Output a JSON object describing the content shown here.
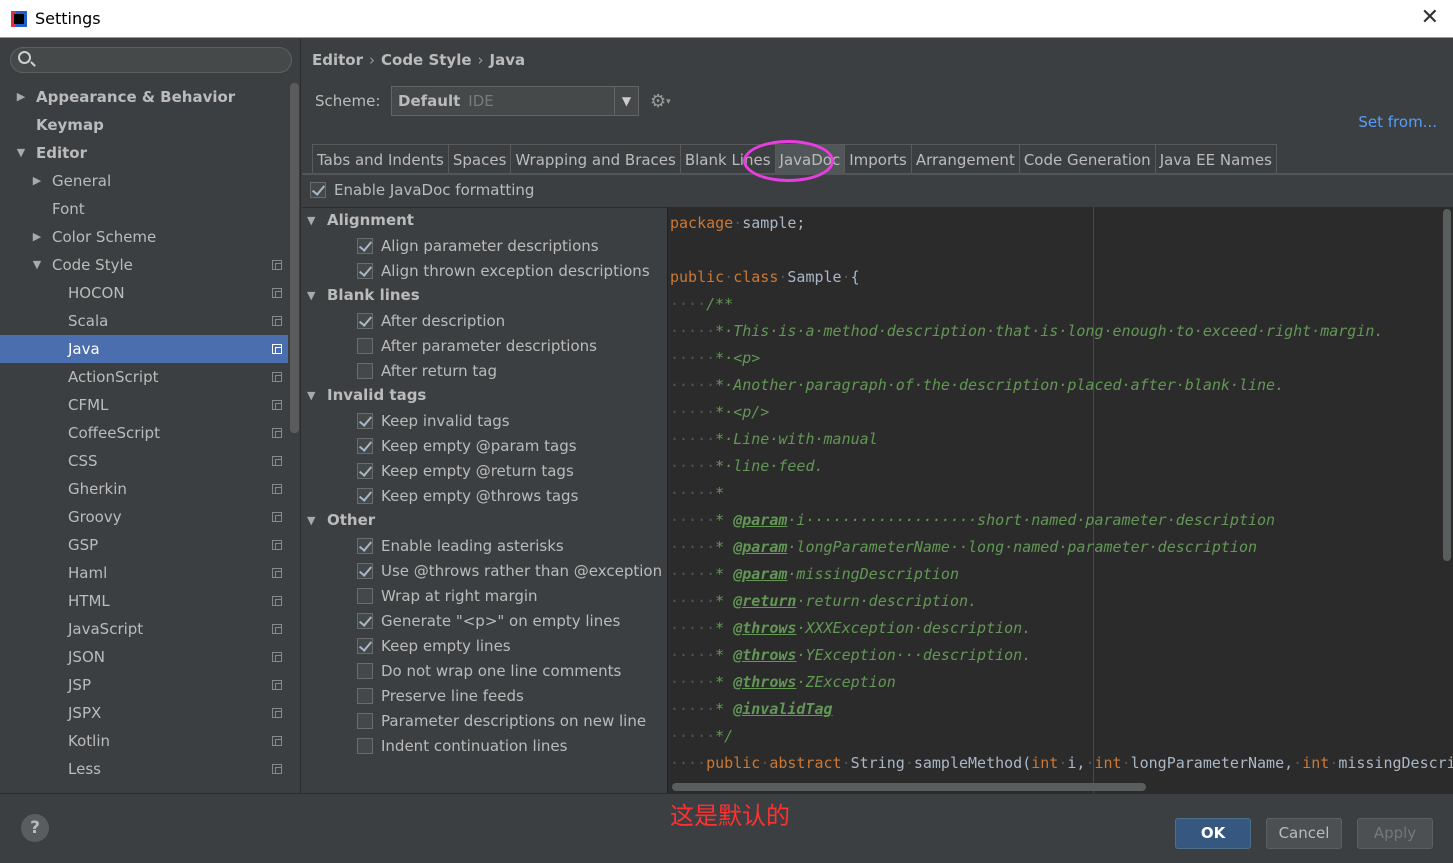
{
  "window": {
    "title": "Settings"
  },
  "sidebar": {
    "search_placeholder": "",
    "items": [
      {
        "label": "Appearance & Behavior",
        "level": 0,
        "arrow": "collapsed",
        "bold": true,
        "copy": false
      },
      {
        "label": "Keymap",
        "level": 0,
        "arrow": "none",
        "bold": true,
        "copy": false
      },
      {
        "label": "Editor",
        "level": 0,
        "arrow": "expanded",
        "bold": true,
        "copy": false
      },
      {
        "label": "General",
        "level": 1,
        "arrow": "collapsed",
        "bold": false,
        "copy": false
      },
      {
        "label": "Font",
        "level": 1,
        "arrow": "none",
        "bold": false,
        "copy": false
      },
      {
        "label": "Color Scheme",
        "level": 1,
        "arrow": "collapsed",
        "bold": false,
        "copy": false
      },
      {
        "label": "Code Style",
        "level": 1,
        "arrow": "expanded",
        "bold": false,
        "copy": true
      },
      {
        "label": "HOCON",
        "level": 2,
        "arrow": "none",
        "bold": false,
        "copy": true
      },
      {
        "label": "Scala",
        "level": 2,
        "arrow": "none",
        "bold": false,
        "copy": true
      },
      {
        "label": "Java",
        "level": 2,
        "arrow": "none",
        "bold": false,
        "copy": true,
        "selected": true
      },
      {
        "label": "ActionScript",
        "level": 2,
        "arrow": "none",
        "bold": false,
        "copy": true
      },
      {
        "label": "CFML",
        "level": 2,
        "arrow": "none",
        "bold": false,
        "copy": true
      },
      {
        "label": "CoffeeScript",
        "level": 2,
        "arrow": "none",
        "bold": false,
        "copy": true
      },
      {
        "label": "CSS",
        "level": 2,
        "arrow": "none",
        "bold": false,
        "copy": true
      },
      {
        "label": "Gherkin",
        "level": 2,
        "arrow": "none",
        "bold": false,
        "copy": true
      },
      {
        "label": "Groovy",
        "level": 2,
        "arrow": "none",
        "bold": false,
        "copy": true
      },
      {
        "label": "GSP",
        "level": 2,
        "arrow": "none",
        "bold": false,
        "copy": true
      },
      {
        "label": "Haml",
        "level": 2,
        "arrow": "none",
        "bold": false,
        "copy": true
      },
      {
        "label": "HTML",
        "level": 2,
        "arrow": "none",
        "bold": false,
        "copy": true
      },
      {
        "label": "JavaScript",
        "level": 2,
        "arrow": "none",
        "bold": false,
        "copy": true
      },
      {
        "label": "JSON",
        "level": 2,
        "arrow": "none",
        "bold": false,
        "copy": true
      },
      {
        "label": "JSP",
        "level": 2,
        "arrow": "none",
        "bold": false,
        "copy": true
      },
      {
        "label": "JSPX",
        "level": 2,
        "arrow": "none",
        "bold": false,
        "copy": true
      },
      {
        "label": "Kotlin",
        "level": 2,
        "arrow": "none",
        "bold": false,
        "copy": true
      },
      {
        "label": "Less",
        "level": 2,
        "arrow": "none",
        "bold": false,
        "copy": true
      }
    ]
  },
  "breadcrumb": [
    "Editor",
    "Code Style",
    "Java"
  ],
  "scheme": {
    "label": "Scheme:",
    "value": "Default",
    "sub": "IDE"
  },
  "set_from": "Set from...",
  "tabs": [
    {
      "label": "Tabs and Indents",
      "active": false
    },
    {
      "label": "Spaces",
      "active": false
    },
    {
      "label": "Wrapping and Braces",
      "active": false
    },
    {
      "label": "Blank Lines",
      "active": false
    },
    {
      "label": "JavaDoc",
      "active": true
    },
    {
      "label": "Imports",
      "active": false
    },
    {
      "label": "Arrangement",
      "active": false
    },
    {
      "label": "Code Generation",
      "active": false
    },
    {
      "label": "Java EE Names",
      "active": false
    }
  ],
  "enable_javadoc": {
    "label": "Enable JavaDoc formatting",
    "checked": true
  },
  "option_groups": [
    {
      "title": "Alignment",
      "options": [
        {
          "label": "Align parameter descriptions",
          "checked": true
        },
        {
          "label": "Align thrown exception descriptions",
          "checked": true
        }
      ]
    },
    {
      "title": "Blank lines",
      "options": [
        {
          "label": "After description",
          "checked": true
        },
        {
          "label": "After parameter descriptions",
          "checked": false
        },
        {
          "label": "After return tag",
          "checked": false
        }
      ]
    },
    {
      "title": "Invalid tags",
      "options": [
        {
          "label": "Keep invalid tags",
          "checked": true
        },
        {
          "label": "Keep empty @param tags",
          "checked": true
        },
        {
          "label": "Keep empty @return tags",
          "checked": true
        },
        {
          "label": "Keep empty @throws tags",
          "checked": true
        }
      ]
    },
    {
      "title": "Other",
      "options": [
        {
          "label": "Enable leading asterisks",
          "checked": true
        },
        {
          "label": "Use @throws rather than @exception",
          "checked": true
        },
        {
          "label": "Wrap at right margin",
          "checked": false
        },
        {
          "label": "Generate \"<p>\" on empty lines",
          "checked": true
        },
        {
          "label": "Keep empty lines",
          "checked": true
        },
        {
          "label": "Do not wrap one line comments",
          "checked": false
        },
        {
          "label": "Preserve line feeds",
          "checked": false
        },
        {
          "label": "Parameter descriptions on new line",
          "checked": false
        },
        {
          "label": "Indent continuation lines",
          "checked": false
        }
      ]
    }
  ],
  "code_lines": [
    [
      [
        "kw",
        "package"
      ],
      [
        "dot",
        "·"
      ],
      [
        "id",
        "sample;"
      ]
    ],
    [],
    [
      [
        "kw",
        "public"
      ],
      [
        "dot",
        "·"
      ],
      [
        "kw",
        "class"
      ],
      [
        "dot",
        "·"
      ],
      [
        "id",
        "Sample"
      ],
      [
        "dot",
        "·"
      ],
      [
        "id",
        "{"
      ]
    ],
    [
      [
        "dot",
        "····"
      ],
      [
        "cm",
        "/**"
      ]
    ],
    [
      [
        "dot",
        "·····"
      ],
      [
        "cm",
        "*·This·is·a·method·description·that·is·long·enough·to·exceed·right·margin."
      ]
    ],
    [
      [
        "dot",
        "·····"
      ],
      [
        "cm",
        "*·<p>"
      ]
    ],
    [
      [
        "dot",
        "·····"
      ],
      [
        "cm",
        "*·Another·paragraph·of·the·description·placed·after·blank·line."
      ]
    ],
    [
      [
        "dot",
        "·····"
      ],
      [
        "cm",
        "*·<p/>"
      ]
    ],
    [
      [
        "dot",
        "·····"
      ],
      [
        "cm",
        "*·Line·with·manual"
      ]
    ],
    [
      [
        "dot",
        "·····"
      ],
      [
        "cm",
        "*·line·feed."
      ]
    ],
    [
      [
        "dot",
        "·····"
      ],
      [
        "cm",
        "*"
      ]
    ],
    [
      [
        "dot",
        "·····"
      ],
      [
        "cm",
        "* "
      ],
      [
        "tg",
        "@param"
      ],
      [
        "cm",
        "·i···················short·named·parameter·description"
      ]
    ],
    [
      [
        "dot",
        "·····"
      ],
      [
        "cm",
        "* "
      ],
      [
        "tg",
        "@param"
      ],
      [
        "cm",
        "·longParameterName··long·named·parameter·description"
      ]
    ],
    [
      [
        "dot",
        "·····"
      ],
      [
        "cm",
        "* "
      ],
      [
        "tg",
        "@param"
      ],
      [
        "cm",
        "·missingDescription"
      ]
    ],
    [
      [
        "dot",
        "·····"
      ],
      [
        "cm",
        "* "
      ],
      [
        "tg",
        "@return"
      ],
      [
        "cm",
        "·return·description."
      ]
    ],
    [
      [
        "dot",
        "·····"
      ],
      [
        "cm",
        "* "
      ],
      [
        "tg",
        "@throws"
      ],
      [
        "cm",
        "·XXXException·description."
      ]
    ],
    [
      [
        "dot",
        "·····"
      ],
      [
        "cm",
        "* "
      ],
      [
        "tg",
        "@throws"
      ],
      [
        "cm",
        "·YException···description."
      ]
    ],
    [
      [
        "dot",
        "·····"
      ],
      [
        "cm",
        "* "
      ],
      [
        "tg",
        "@throws"
      ],
      [
        "cm",
        "·ZException"
      ]
    ],
    [
      [
        "dot",
        "·····"
      ],
      [
        "cm",
        "* "
      ],
      [
        "tg",
        "@invalidTag"
      ]
    ],
    [
      [
        "dot",
        "·····"
      ],
      [
        "cm",
        "*/"
      ]
    ],
    [
      [
        "dot",
        "····"
      ],
      [
        "kw",
        "public"
      ],
      [
        "dot",
        "·"
      ],
      [
        "kw",
        "abstract"
      ],
      [
        "dot",
        "·"
      ],
      [
        "id",
        "String"
      ],
      [
        "dot",
        "·"
      ],
      [
        "id",
        "sampleMethod("
      ],
      [
        "kw",
        "int"
      ],
      [
        "dot",
        "·"
      ],
      [
        "id",
        "i,"
      ],
      [
        "dot",
        "·"
      ],
      [
        "kw",
        "int"
      ],
      [
        "dot",
        "·"
      ],
      [
        "id",
        "longParameterName,"
      ],
      [
        "dot",
        "·"
      ],
      [
        "kw",
        "int"
      ],
      [
        "dot",
        "·"
      ],
      [
        "id",
        "missingDescription);"
      ]
    ]
  ],
  "annotation_note": "这是默认的",
  "buttons": {
    "ok": "OK",
    "cancel": "Cancel",
    "apply": "Apply",
    "help": "?"
  },
  "colors": {
    "selection": "#4b6eaf",
    "highlight_circle": "#e83de0",
    "link": "#589df6",
    "note": "#ff3030"
  }
}
